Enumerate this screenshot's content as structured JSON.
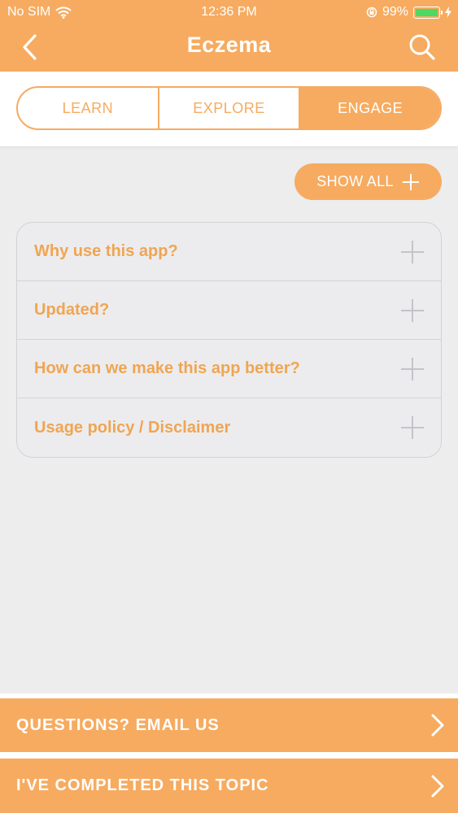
{
  "status_bar": {
    "carrier": "No SIM",
    "time": "12:36 PM",
    "battery_percent": "99%",
    "icons": [
      "wifi-icon",
      "orientation-lock-icon",
      "battery-icon",
      "charging-bolt-icon"
    ]
  },
  "nav": {
    "title": "Eczema",
    "back_icon": "chevron-left-icon",
    "search_icon": "search-icon"
  },
  "tabs": [
    {
      "label": "LEARN",
      "active": false
    },
    {
      "label": "EXPLORE",
      "active": false
    },
    {
      "label": "ENGAGE",
      "active": true
    }
  ],
  "show_all": {
    "label": "SHOW ALL",
    "icon": "plus-icon"
  },
  "accordion": [
    {
      "label": "Why use this app?"
    },
    {
      "label": "Updated?"
    },
    {
      "label": "How can we make this app better?"
    },
    {
      "label": "Usage policy / Disclaimer"
    }
  ],
  "bottom_buttons": [
    {
      "label": "QUESTIONS? EMAIL US",
      "icon": "chevron-right-icon"
    },
    {
      "label": "I'VE COMPLETED THIS TOPIC",
      "icon": "chevron-right-icon"
    }
  ],
  "colors": {
    "accent": "#f6ab60",
    "accordion_text": "#f0a552",
    "background": "#ededee",
    "battery_fill": "#4cd964"
  }
}
